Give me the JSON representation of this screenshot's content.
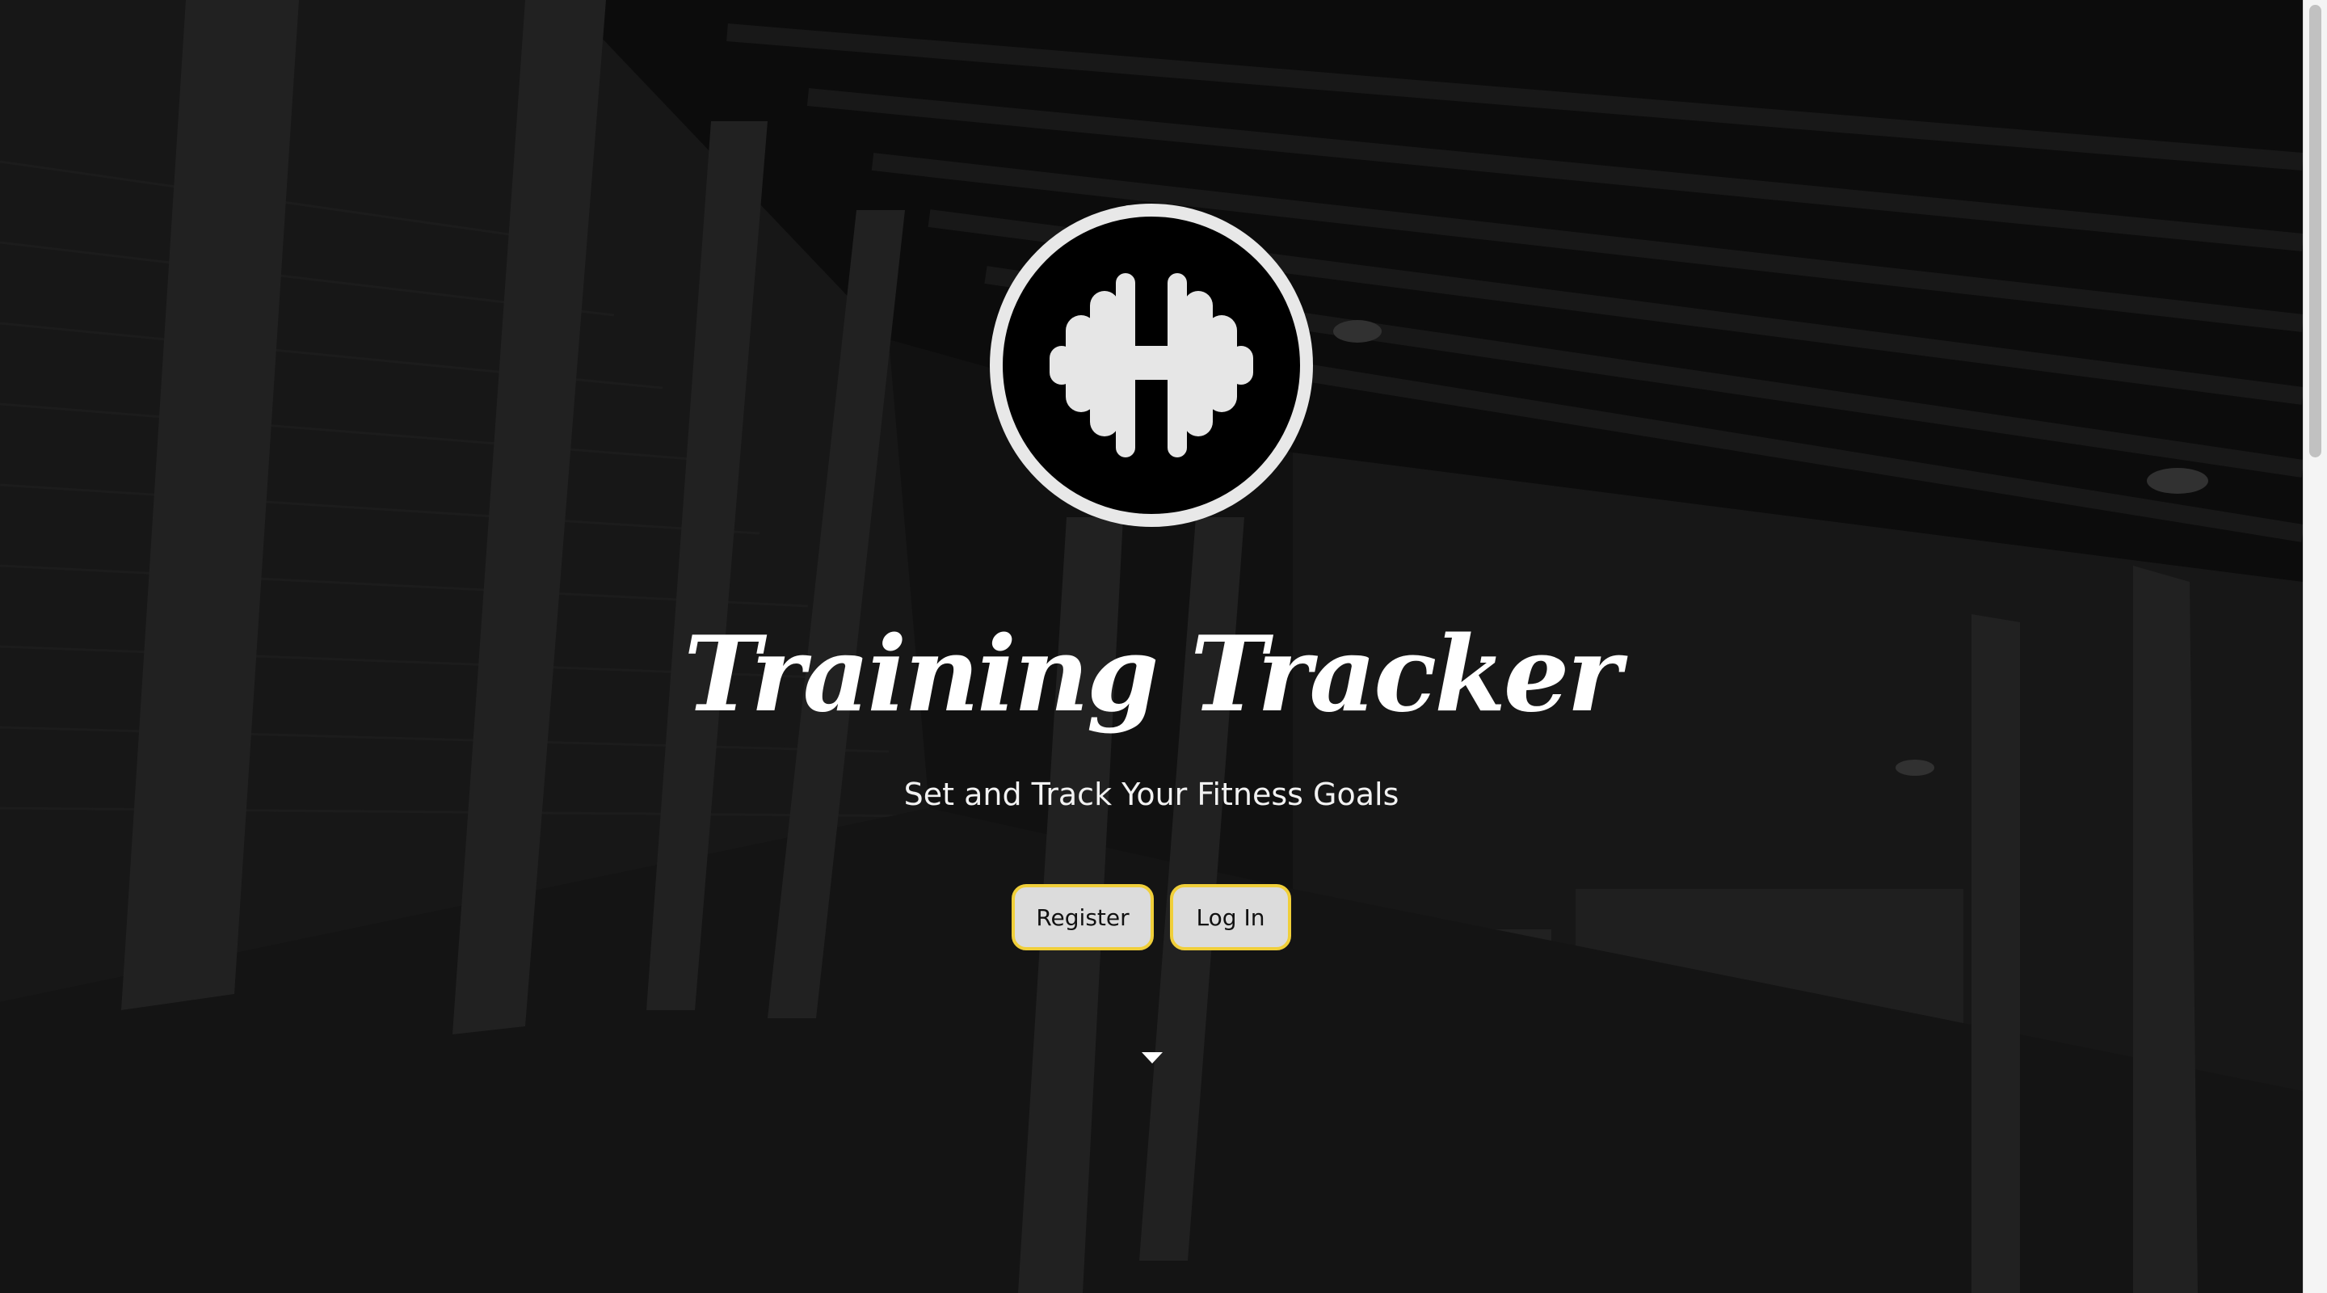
{
  "hero": {
    "title": "Training Tracker",
    "subtitle": "Set and Track Your Fitness Goals",
    "logo_icon": "dumbbell-icon"
  },
  "actions": {
    "register_label": "Register",
    "login_label": "Log In"
  },
  "scroll_indicator_icon": "chevron-down-icon",
  "colors": {
    "button_border": "#f0cf3a",
    "button_fill": "#dcdcdc",
    "logo_ring": "#e8e8e8",
    "logo_fill": "#000000",
    "text": "#ffffff"
  }
}
